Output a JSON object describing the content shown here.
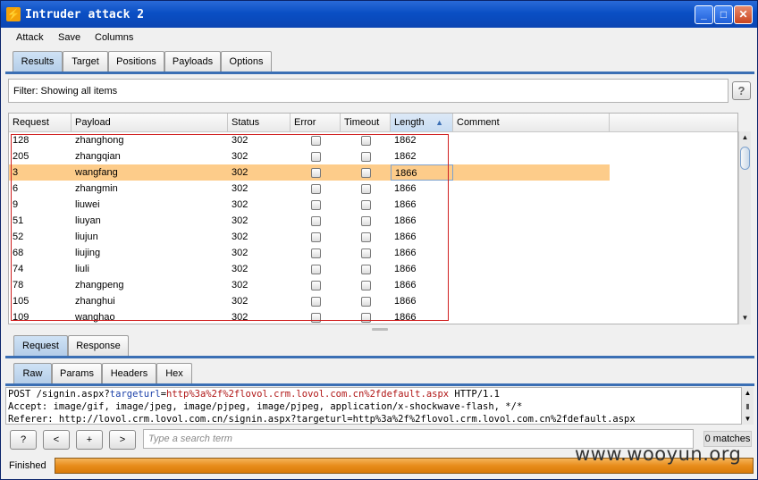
{
  "window": {
    "title": "Intruder attack 2",
    "app_icon": "⚡"
  },
  "menu": [
    "Attack",
    "Save",
    "Columns"
  ],
  "main_tabs": [
    {
      "label": "Results",
      "active": true
    },
    {
      "label": "Target",
      "active": false
    },
    {
      "label": "Positions",
      "active": false
    },
    {
      "label": "Payloads",
      "active": false
    },
    {
      "label": "Options",
      "active": false
    }
  ],
  "filter": {
    "text": "Filter:  Showing all items"
  },
  "help_label": "?",
  "table": {
    "columns": [
      "Request",
      "Payload",
      "Status",
      "Error",
      "Timeout",
      "Length",
      "Comment"
    ],
    "sort_arrow": "▲",
    "selected_index": 2,
    "rows": [
      {
        "request": "128",
        "payload": "zhanghong",
        "status": "302",
        "length": "1862"
      },
      {
        "request": "205",
        "payload": "zhangqian",
        "status": "302",
        "length": "1862"
      },
      {
        "request": "3",
        "payload": "wangfang",
        "status": "302",
        "length": "1866"
      },
      {
        "request": "6",
        "payload": "zhangmin",
        "status": "302",
        "length": "1866"
      },
      {
        "request": "9",
        "payload": "liuwei",
        "status": "302",
        "length": "1866"
      },
      {
        "request": "51",
        "payload": "liuyan",
        "status": "302",
        "length": "1866"
      },
      {
        "request": "52",
        "payload": "liujun",
        "status": "302",
        "length": "1866"
      },
      {
        "request": "68",
        "payload": "liujing",
        "status": "302",
        "length": "1866"
      },
      {
        "request": "74",
        "payload": "liuli",
        "status": "302",
        "length": "1866"
      },
      {
        "request": "78",
        "payload": "zhangpeng",
        "status": "302",
        "length": "1866"
      },
      {
        "request": "105",
        "payload": "zhanghui",
        "status": "302",
        "length": "1866"
      },
      {
        "request": "109",
        "payload": "wanghao",
        "status": "302",
        "length": "1866"
      }
    ]
  },
  "detail_tabs": [
    {
      "label": "Request",
      "active": true
    },
    {
      "label": "Response",
      "active": false
    }
  ],
  "view_tabs": [
    {
      "label": "Raw",
      "active": true
    },
    {
      "label": "Params",
      "active": false
    },
    {
      "label": "Headers",
      "active": false
    },
    {
      "label": "Hex",
      "active": false
    }
  ],
  "request_text": {
    "l1_a": "POST /signin.aspx?",
    "l1_param": "targeturl",
    "l1_eq": "=",
    "l1_url": "http%3a%2f%2flovol.crm.lovol.com.cn%2fdefault.aspx",
    "l1_end": " HTTP/1.1",
    "l2": "Accept: image/gif, image/jpeg, image/pjpeg, image/pjpeg, application/x-shockwave-flash, */*",
    "l3": "Referer: http://lovol.crm.lovol.com.cn/signin.aspx?targeturl=http%3a%2f%2flovol.crm.lovol.com.cn%2fdefault.aspx"
  },
  "search": {
    "help": "?",
    "prev": "<",
    "add": "+",
    "next": ">",
    "placeholder": "Type a search term",
    "matches": "0 matches"
  },
  "status": {
    "text": "Finished",
    "progress": 1.0
  },
  "watermark": "www.wooyun.org",
  "colors": {
    "selection": "#fdcc8a",
    "progress": "#e88d1b",
    "tab_rule": "#3b6fb4",
    "highlight_box": "#d02020"
  }
}
